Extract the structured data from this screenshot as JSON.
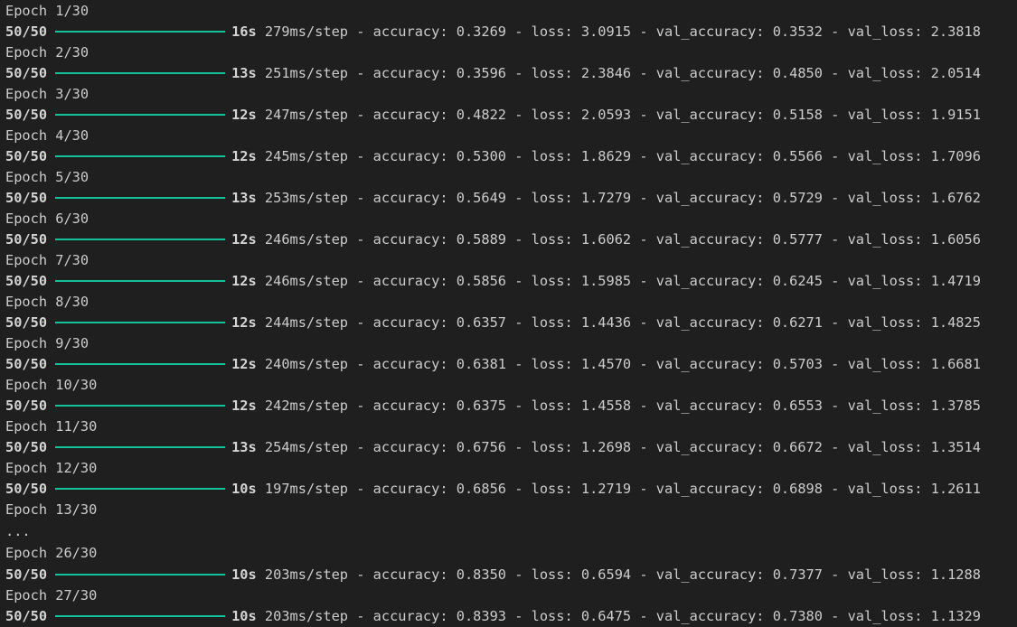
{
  "accent_color": "#13c29a",
  "log": [
    {
      "type": "epoch",
      "text": "Epoch 1/30"
    },
    {
      "type": "progress",
      "steps": "50/50",
      "time": "16s",
      "rest": "279ms/step - accuracy: 0.3269 - loss: 3.0915 - val_accuracy: 0.3532 - val_loss: 2.3818"
    },
    {
      "type": "epoch",
      "text": "Epoch 2/30"
    },
    {
      "type": "progress",
      "steps": "50/50",
      "time": "13s",
      "rest": "251ms/step - accuracy: 0.3596 - loss: 2.3846 - val_accuracy: 0.4850 - val_loss: 2.0514"
    },
    {
      "type": "epoch",
      "text": "Epoch 3/30"
    },
    {
      "type": "progress",
      "steps": "50/50",
      "time": "12s",
      "rest": "247ms/step - accuracy: 0.4822 - loss: 2.0593 - val_accuracy: 0.5158 - val_loss: 1.9151"
    },
    {
      "type": "epoch",
      "text": "Epoch 4/30"
    },
    {
      "type": "progress",
      "steps": "50/50",
      "time": "12s",
      "rest": "245ms/step - accuracy: 0.5300 - loss: 1.8629 - val_accuracy: 0.5566 - val_loss: 1.7096"
    },
    {
      "type": "epoch",
      "text": "Epoch 5/30"
    },
    {
      "type": "progress",
      "steps": "50/50",
      "time": "13s",
      "rest": "253ms/step - accuracy: 0.5649 - loss: 1.7279 - val_accuracy: 0.5729 - val_loss: 1.6762"
    },
    {
      "type": "epoch",
      "text": "Epoch 6/30"
    },
    {
      "type": "progress",
      "steps": "50/50",
      "time": "12s",
      "rest": "246ms/step - accuracy: 0.5889 - loss: 1.6062 - val_accuracy: 0.5777 - val_loss: 1.6056"
    },
    {
      "type": "epoch",
      "text": "Epoch 7/30"
    },
    {
      "type": "progress",
      "steps": "50/50",
      "time": "12s",
      "rest": "246ms/step - accuracy: 0.5856 - loss: 1.5985 - val_accuracy: 0.6245 - val_loss: 1.4719"
    },
    {
      "type": "epoch",
      "text": "Epoch 8/30"
    },
    {
      "type": "progress",
      "steps": "50/50",
      "time": "12s",
      "rest": "244ms/step - accuracy: 0.6357 - loss: 1.4436 - val_accuracy: 0.6271 - val_loss: 1.4825"
    },
    {
      "type": "epoch",
      "text": "Epoch 9/30"
    },
    {
      "type": "progress",
      "steps": "50/50",
      "time": "12s",
      "rest": "240ms/step - accuracy: 0.6381 - loss: 1.4570 - val_accuracy: 0.5703 - val_loss: 1.6681"
    },
    {
      "type": "epoch",
      "text": "Epoch 10/30"
    },
    {
      "type": "progress",
      "steps": "50/50",
      "time": "12s",
      "rest": "242ms/step - accuracy: 0.6375 - loss: 1.4558 - val_accuracy: 0.6553 - val_loss: 1.3785"
    },
    {
      "type": "epoch",
      "text": "Epoch 11/30"
    },
    {
      "type": "progress",
      "steps": "50/50",
      "time": "13s",
      "rest": "254ms/step - accuracy: 0.6756 - loss: 1.2698 - val_accuracy: 0.6672 - val_loss: 1.3514"
    },
    {
      "type": "epoch",
      "text": "Epoch 12/30"
    },
    {
      "type": "progress",
      "steps": "50/50",
      "time": "10s",
      "rest": "197ms/step - accuracy: 0.6856 - loss: 1.2719 - val_accuracy: 0.6898 - val_loss: 1.2611"
    },
    {
      "type": "epoch",
      "text": "Epoch 13/30"
    },
    {
      "type": "text",
      "text": "..."
    },
    {
      "type": "epoch",
      "text": "Epoch 26/30"
    },
    {
      "type": "progress",
      "steps": "50/50",
      "time": "10s",
      "rest": "203ms/step - accuracy: 0.8350 - loss: 0.6594 - val_accuracy: 0.7377 - val_loss: 1.1288"
    },
    {
      "type": "epoch",
      "text": "Epoch 27/30"
    },
    {
      "type": "progress",
      "steps": "50/50",
      "time": "10s",
      "rest": "203ms/step - accuracy: 0.8393 - loss: 0.6475 - val_accuracy: 0.7380 - val_loss: 1.1329"
    }
  ]
}
